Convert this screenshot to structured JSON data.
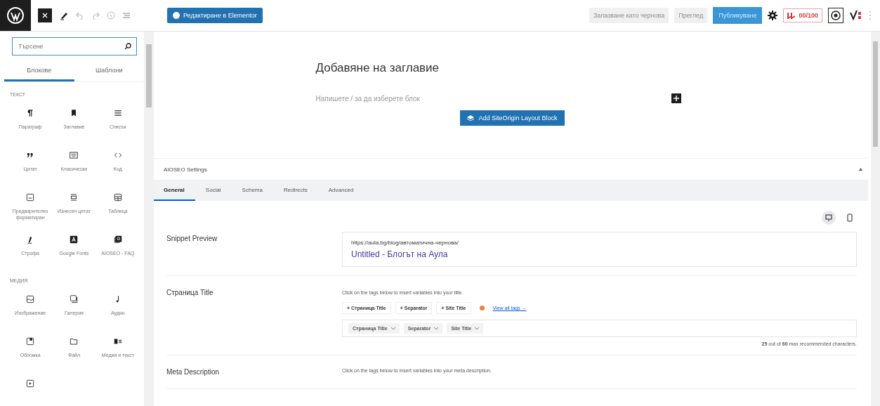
{
  "toolbar": {
    "elementor_button": "Редактиране в Elementor",
    "save_draft": "Запазване като чернова",
    "preview": "Преглед",
    "publish": "Публикуване",
    "seo_score": "00/100"
  },
  "inserter": {
    "search": {
      "placeholder": "Търсене"
    },
    "tabs": [
      {
        "label": "Блокове",
        "selected": true
      },
      {
        "label": "Шаблони",
        "selected": false
      }
    ],
    "categories": [
      {
        "title": "ТЕКСТ",
        "blocks": [
          "Параграф",
          "Заглавие",
          "Списък",
          "Цитат",
          "Класически",
          "Код",
          "Предварително форматиран",
          "Изнесен цитат",
          "Таблица",
          "Строфа",
          "Google Fonts",
          "AIOSEO - FAQ"
        ]
      },
      {
        "title": "МЕДИЯ",
        "blocks": [
          "Изображение",
          "Галерия",
          "Аудио",
          "Обложка",
          "Файл",
          "Медия и текст"
        ]
      }
    ]
  },
  "editor": {
    "title_placeholder": "Добавяне на заглавие",
    "block_placeholder": "Напишете / за да изберете блок",
    "siteorigin_button": "Add SiteOrigin Layout Block"
  },
  "aioseo": {
    "title": "AIOSEO Settings",
    "tabs": [
      {
        "label": "General",
        "selected": true
      },
      {
        "label": "Social",
        "selected": false
      },
      {
        "label": "Schema",
        "selected": false
      },
      {
        "label": "Redirects",
        "selected": false
      },
      {
        "label": "Advanced",
        "selected": false
      }
    ],
    "snippet": {
      "label": "Snippet Preview",
      "url": "https://aula.bg/blog/автоматична-чернова/",
      "title": "Untitled - Блогът на Аула"
    },
    "page_title": {
      "label": "Страница Title",
      "hint": "Click on the tags below to insert variables into your title.",
      "tag_buttons": [
        "+ Страница Title",
        "+ Separator",
        "+ Site Title"
      ],
      "view_all": "View all tags →",
      "tokens": [
        "Страница Title",
        "Separator",
        "Site Title"
      ],
      "counter": "**25** out of **60** max recommended characters."
    },
    "meta": {
      "label": "Meta Description",
      "hint": "Click on the tags below to insert variables into your meta description."
    }
  }
}
